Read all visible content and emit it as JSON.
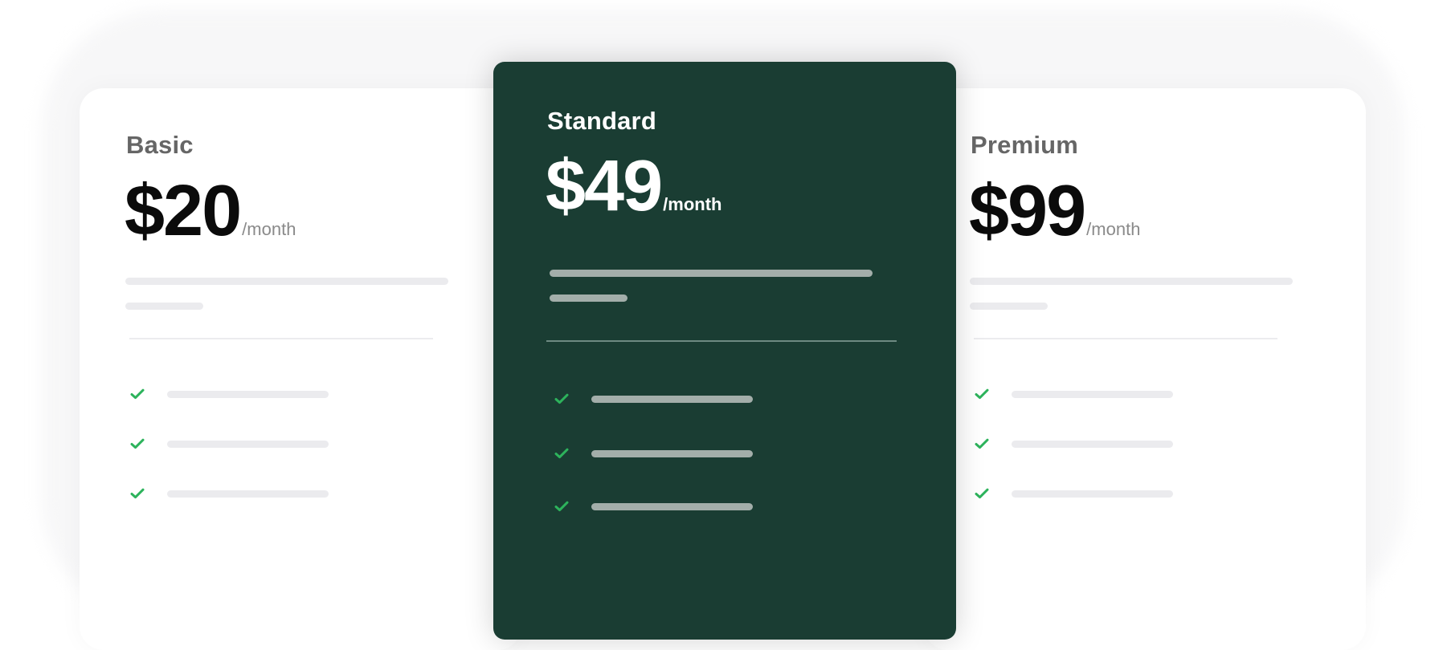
{
  "plans": [
    {
      "name": "Basic",
      "price": "$20",
      "period": "/month",
      "features": [
        "",
        "",
        ""
      ]
    },
    {
      "name": "Standard",
      "price": "$49",
      "period": "/month",
      "features": [
        "",
        "",
        ""
      ],
      "featured": true
    },
    {
      "name": "Premium",
      "price": "$99",
      "period": "/month",
      "features": [
        "",
        "",
        ""
      ]
    }
  ],
  "colors": {
    "featured_background": "#1a3d33",
    "check_green": "#2db35c",
    "placeholder_light": "#ebebee",
    "placeholder_on_dark": "#a3aeaa"
  },
  "icons": {
    "feature_marker": "check-icon"
  }
}
